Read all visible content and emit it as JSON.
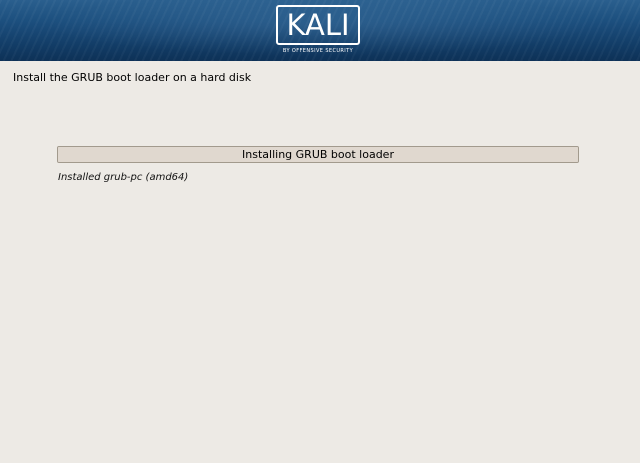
{
  "banner": {
    "logo_text": "KALI",
    "logo_tagline": "BY OFFENSIVE SECURITY",
    "logo_icon": "kali-logo-icon"
  },
  "installer": {
    "step_title": "Install the GRUB boot loader on a hard disk",
    "progress_label": "Installing GRUB boot loader",
    "progress_fraction": 1.0,
    "status_text": "Installed grub-pc (amd64)"
  },
  "colors": {
    "banner_blue": "#1c4f7e",
    "background": "#edeae5",
    "progress_fill": "#e0d8cf",
    "progress_border": "#a29a8d"
  }
}
